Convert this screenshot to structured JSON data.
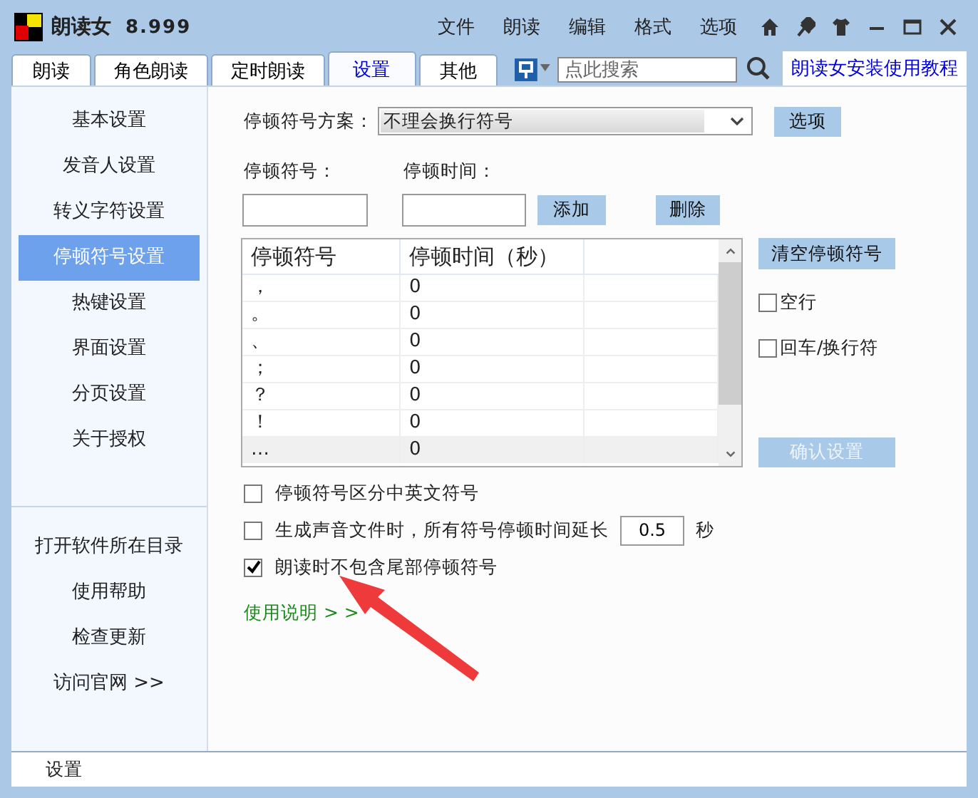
{
  "window": {
    "title": "朗读女",
    "version": "8.999"
  },
  "menu": [
    "文件",
    "朗读",
    "编辑",
    "格式",
    "选项"
  ],
  "tabs": [
    {
      "label": "朗读",
      "selected": false
    },
    {
      "label": "角色朗读",
      "selected": false
    },
    {
      "label": "定时朗读",
      "selected": false
    },
    {
      "label": "设置",
      "selected": true
    },
    {
      "label": "其他",
      "selected": false
    }
  ],
  "search": {
    "placeholder": "点此搜索"
  },
  "help_link": "朗读女安装使用教程",
  "sidebar": {
    "items": [
      {
        "label": "基本设置",
        "selected": false
      },
      {
        "label": "发音人设置",
        "selected": false
      },
      {
        "label": "转义字符设置",
        "selected": false
      },
      {
        "label": "停顿符号设置",
        "selected": true
      },
      {
        "label": "热键设置",
        "selected": false
      },
      {
        "label": "界面设置",
        "selected": false
      },
      {
        "label": "分页设置",
        "selected": false
      },
      {
        "label": "关于授权",
        "selected": false
      }
    ],
    "links": [
      "打开软件所在目录",
      "使用帮助",
      "检查更新",
      "访问官网 >>"
    ]
  },
  "content": {
    "scheme_label": "停顿符号方案：",
    "scheme_value": "不理会换行符号",
    "options_button": "选项",
    "symbol_label": "停顿符号：",
    "time_label": "停顿时间：",
    "add_button": "添加",
    "delete_button": "删除",
    "table": {
      "columns": [
        "停顿符号",
        "停顿时间（秒）"
      ],
      "rows": [
        [
          "，",
          "0"
        ],
        [
          "。",
          "0"
        ],
        [
          "、",
          "0"
        ],
        [
          "；",
          "0"
        ],
        [
          "？",
          "0"
        ],
        [
          "！",
          "0"
        ],
        [
          "…",
          "0"
        ]
      ]
    },
    "clear_button": "清空停顿符号",
    "line_options": [
      {
        "label": "空行",
        "checked": false
      },
      {
        "label": "回车/换行符",
        "checked": false
      }
    ],
    "confirm_button": {
      "label": "确认设置",
      "disabled": true
    },
    "options": [
      {
        "kind": "plain",
        "label": "停顿符号区分中英文符号",
        "checked": false
      },
      {
        "kind": "value",
        "label": "生成声音文件时，所有符号停顿时间延长",
        "checked": false,
        "value": "0.5",
        "unit": "秒"
      },
      {
        "kind": "plain",
        "label": "朗读时不包含尾部停顿符号",
        "checked": true
      }
    ],
    "usage_link": "使用说明 > >"
  },
  "status_bar": "设置"
}
